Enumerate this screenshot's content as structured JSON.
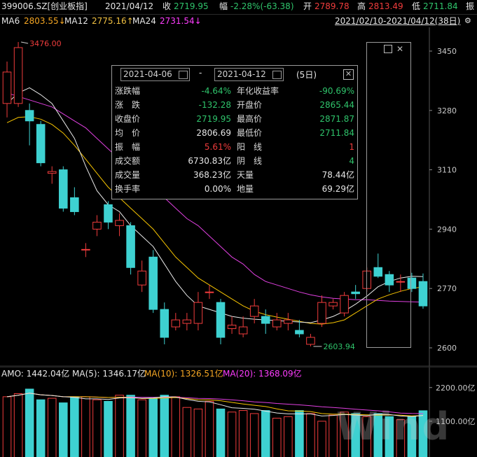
{
  "header": {
    "symbol": "399006.SZ[创业板指]",
    "date": "2021/04/12",
    "close_label": "收",
    "close": "2719.95",
    "range_label": "幅",
    "change": "-2.28%(-63.38)",
    "open_label": "开",
    "open": "2789.78",
    "high_label": "高",
    "high": "2813.49",
    "low_label": "低",
    "low": "2711.84",
    "amp_label": "振"
  },
  "ma_bar": {
    "ma6_label": "MA6",
    "ma6": "2803.55↓",
    "ma12_label": "MA12",
    "ma12": "2775.16↑",
    "ma24_label": "MA24",
    "ma24": "2731.54↓",
    "range": "2021/02/10-2021/04/12(38日)"
  },
  "colors": {
    "up": "#f03c3c",
    "down": "#3ed1d1",
    "ma6": "#e8e8e8",
    "ma12": "#f5c300",
    "ma24": "#e040e0",
    "background": "#000000"
  },
  "annotations": {
    "high_mark": "3476.00",
    "low_mark": "2603.94"
  },
  "popup": {
    "start_date": "2021-04-06",
    "end_date": "2021-04-12",
    "separator": "-",
    "days": "(5日)",
    "left": [
      {
        "label": "涨跌幅",
        "value": "-4.64%",
        "color": "green"
      },
      {
        "label": "涨　跌",
        "value": "-132.28",
        "color": "green"
      },
      {
        "label": "收盘价",
        "value": "2719.95",
        "color": "green"
      },
      {
        "label": "均　价",
        "value": "2806.69",
        "color": "white"
      },
      {
        "label": "振　幅",
        "value": "5.61%",
        "color": "red"
      },
      {
        "label": "成交额",
        "value": "6730.83亿",
        "color": "white"
      },
      {
        "label": "成交量",
        "value": "368.23亿",
        "color": "white"
      },
      {
        "label": "换手率",
        "value": "0.00%",
        "color": "white"
      }
    ],
    "right": [
      {
        "label": "年化收益率",
        "value": "-90.69%",
        "color": "green"
      },
      {
        "label": "开盘价",
        "value": "2865.44",
        "color": "green"
      },
      {
        "label": "最高价",
        "value": "2871.87",
        "color": "green"
      },
      {
        "label": "最低价",
        "value": "2711.84",
        "color": "green"
      },
      {
        "label": "阳　线",
        "value": "1",
        "color": "red"
      },
      {
        "label": "阴　线",
        "value": "4",
        "color": "green"
      },
      {
        "label": "天量",
        "value": "78.44亿",
        "color": "white"
      },
      {
        "label": "地量",
        "value": "69.29亿",
        "color": "white"
      }
    ]
  },
  "volume_header": {
    "amo": "AMO: 1442.04亿",
    "ma5": "MA(5): 1346.17亿",
    "ma10": "MA(10): 1326.51亿",
    "ma20": "MA(20): 1368.09亿"
  },
  "watermark": "Wind",
  "chart_data": {
    "type": "candlestick",
    "y_ticks": [
      "3450",
      "3280",
      "3110",
      "2940",
      "2770",
      "2600"
    ],
    "ylim": [
      2580,
      3510
    ],
    "volume_ticks": [
      "2200.00亿",
      "1100.00亿"
    ],
    "volume_ylim": [
      0,
      2400
    ],
    "candles": [
      {
        "o": 3300,
        "c": 3390,
        "h": 3420,
        "l": 3260
      },
      {
        "o": 3300,
        "c": 3460,
        "h": 3476,
        "l": 3290
      },
      {
        "o": 3280,
        "c": 3250,
        "h": 3300,
        "l": 3180
      },
      {
        "o": 3240,
        "c": 3130,
        "h": 3250,
        "l": 3120
      },
      {
        "o": 3100,
        "c": 3105,
        "h": 3120,
        "l": 3070
      },
      {
        "o": 3110,
        "c": 3000,
        "h": 3120,
        "l": 2990
      },
      {
        "o": 3030,
        "c": 2990,
        "h": 3060,
        "l": 2980
      },
      {
        "o": 2880,
        "c": 2882,
        "h": 2900,
        "l": 2860
      },
      {
        "o": 2940,
        "c": 2960,
        "h": 2980,
        "l": 2920
      },
      {
        "o": 3010,
        "c": 2960,
        "h": 3020,
        "l": 2940
      },
      {
        "o": 2950,
        "c": 2965,
        "h": 2985,
        "l": 2920
      },
      {
        "o": 2950,
        "c": 2830,
        "h": 2960,
        "l": 2810
      },
      {
        "o": 2780,
        "c": 2820,
        "h": 2850,
        "l": 2760
      },
      {
        "o": 2860,
        "c": 2710,
        "h": 2880,
        "l": 2700
      },
      {
        "o": 2710,
        "c": 2630,
        "h": 2730,
        "l": 2610
      },
      {
        "o": 2660,
        "c": 2680,
        "h": 2700,
        "l": 2650
      },
      {
        "o": 2670,
        "c": 2680,
        "h": 2700,
        "l": 2650
      },
      {
        "o": 2670,
        "c": 2730,
        "h": 2760,
        "l": 2650
      },
      {
        "o": 2760,
        "c": 2760,
        "h": 2780,
        "l": 2740
      },
      {
        "o": 2730,
        "c": 2630,
        "h": 2740,
        "l": 2610
      },
      {
        "o": 2655,
        "c": 2665,
        "h": 2690,
        "l": 2640
      },
      {
        "o": 2640,
        "c": 2660,
        "h": 2690,
        "l": 2630
      },
      {
        "o": 2690,
        "c": 2720,
        "h": 2740,
        "l": 2670
      },
      {
        "o": 2690,
        "c": 2670,
        "h": 2710,
        "l": 2640
      },
      {
        "o": 2660,
        "c": 2680,
        "h": 2700,
        "l": 2650
      },
      {
        "o": 2670,
        "c": 2680,
        "h": 2700,
        "l": 2650
      },
      {
        "o": 2650,
        "c": 2640,
        "h": 2680,
        "l": 2630
      },
      {
        "o": 2610,
        "c": 2630,
        "h": 2640,
        "l": 2604
      },
      {
        "o": 2670,
        "c": 2730,
        "h": 2750,
        "l": 2660
      },
      {
        "o": 2720,
        "c": 2730,
        "h": 2740,
        "l": 2710
      },
      {
        "o": 2700,
        "c": 2750,
        "h": 2760,
        "l": 2690
      },
      {
        "o": 2760,
        "c": 2755,
        "h": 2780,
        "l": 2740
      },
      {
        "o": 2770,
        "c": 2820,
        "h": 2830,
        "l": 2760
      },
      {
        "o": 2830,
        "c": 2805,
        "h": 2870,
        "l": 2800
      },
      {
        "o": 2810,
        "c": 2780,
        "h": 2820,
        "l": 2760
      },
      {
        "o": 2790,
        "c": 2790,
        "h": 2810,
        "l": 2760
      },
      {
        "o": 2800,
        "c": 2770,
        "h": 2815,
        "l": 2760
      },
      {
        "o": 2790,
        "c": 2720,
        "h": 2813,
        "l": 2712
      }
    ],
    "volume": [
      1900,
      2000,
      2150,
      1800,
      1850,
      1700,
      1900,
      1900,
      1800,
      1750,
      1950,
      1950,
      1800,
      1850,
      1950,
      1900,
      1550,
      1500,
      1750,
      1500,
      1400,
      1450,
      1350,
      1450,
      1200,
      1250,
      1450,
      1350,
      1100,
      1300,
      1400,
      1350,
      1250,
      1350,
      1250,
      1150,
      1250,
      1442
    ],
    "ma6": [
      3300,
      3330,
      3345,
      3325,
      3300,
      3250,
      3200,
      3120,
      3050,
      3010,
      2990,
      2950,
      2920,
      2890,
      2840,
      2790,
      2750,
      2720,
      2710,
      2700,
      2690,
      2685,
      2682,
      2680,
      2678,
      2676,
      2674,
      2672,
      2680,
      2690,
      2705,
      2725,
      2748,
      2775,
      2790,
      2800,
      2805,
      2804
    ],
    "ma12": [
      3245,
      3260,
      3262,
      3255,
      3240,
      3215,
      3180,
      3140,
      3100,
      3060,
      3030,
      3000,
      2970,
      2940,
      2900,
      2860,
      2830,
      2800,
      2780,
      2760,
      2740,
      2720,
      2705,
      2695,
      2688,
      2682,
      2676,
      2670,
      2668,
      2672,
      2680,
      2700,
      2720,
      2740,
      2752,
      2762,
      2770,
      2775
    ],
    "ma24": [
      3330,
      3320,
      3310,
      3300,
      3290,
      3270,
      3250,
      3230,
      3200,
      3170,
      3140,
      3110,
      3080,
      3060,
      3030,
      3000,
      2970,
      2950,
      2920,
      2890,
      2860,
      2840,
      2810,
      2790,
      2780,
      2770,
      2760,
      2752,
      2746,
      2742,
      2740,
      2738,
      2738,
      2736,
      2734,
      2733,
      2732,
      2731
    ]
  }
}
